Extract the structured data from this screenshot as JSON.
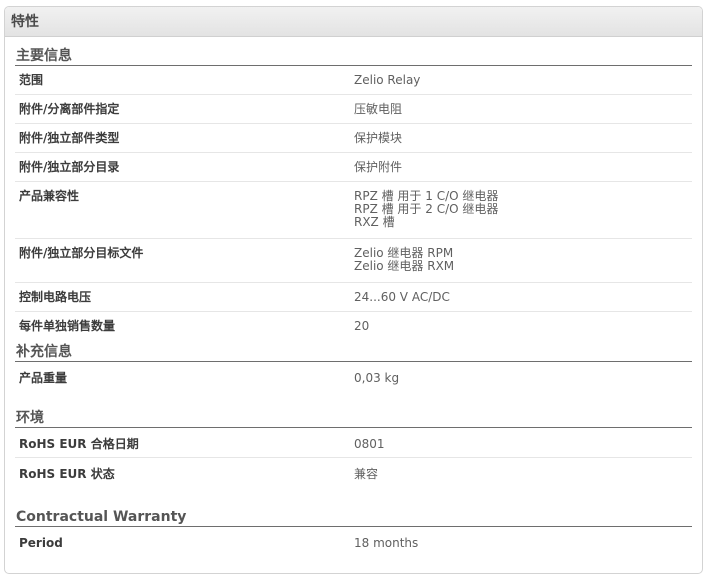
{
  "panel": {
    "title": "特性"
  },
  "sections": [
    {
      "title": "主要信息",
      "rows": [
        {
          "label": "范围",
          "values": [
            "Zelio Relay"
          ]
        },
        {
          "label": "附件/分离部件指定",
          "values": [
            "压敏电阻"
          ]
        },
        {
          "label": "附件/独立部件类型",
          "values": [
            "保护模块"
          ]
        },
        {
          "label": "附件/独立部分目录",
          "values": [
            "保护附件"
          ]
        },
        {
          "label": "产品兼容性",
          "values": [
            "RPZ 槽 用于 1 C/O 继电器",
            "RPZ 槽 用于 2 C/O 继电器",
            "RXZ 槽"
          ]
        },
        {
          "label": "附件/独立部分目标文件",
          "values": [
            "Zelio 继电器 RPM",
            "Zelio 继电器 RXM"
          ]
        },
        {
          "label": "控制电路电压",
          "values": [
            "24...60 V AC/DC"
          ]
        },
        {
          "label": "每件单独销售数量",
          "values": [
            "20"
          ]
        }
      ]
    },
    {
      "title": "补充信息",
      "rows": [
        {
          "label": "产品重量",
          "values": [
            "0,03 kg"
          ]
        }
      ]
    },
    {
      "title": "环境",
      "rows": [
        {
          "label": "RoHS EUR 合格日期",
          "values": [
            "0801"
          ]
        },
        {
          "label": "RoHS EUR 状态",
          "values": [
            "兼容"
          ]
        }
      ]
    },
    {
      "title": "Contractual Warranty",
      "rows": [
        {
          "label": "Period",
          "values": [
            "18 months"
          ]
        }
      ]
    }
  ]
}
